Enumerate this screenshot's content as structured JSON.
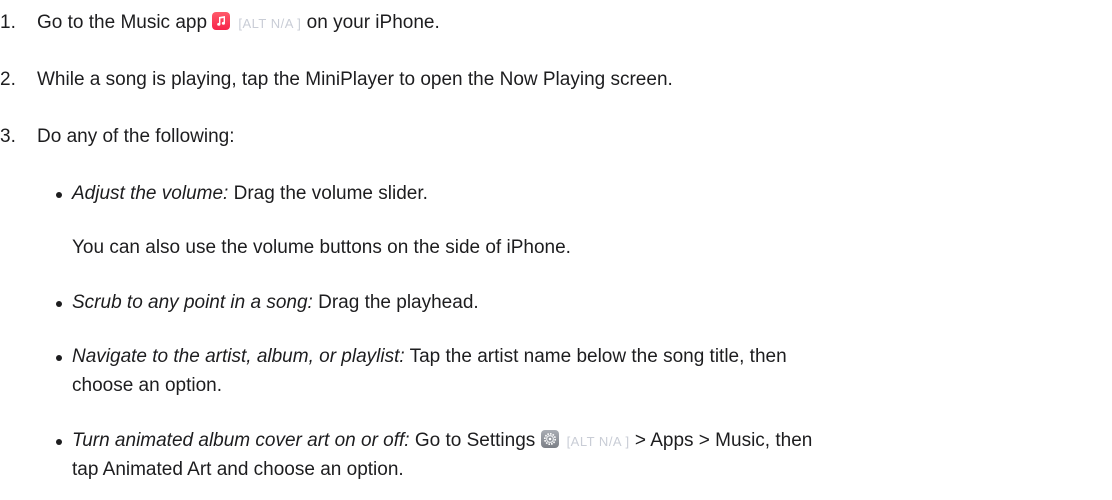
{
  "steps": [
    {
      "number": "1.",
      "pre": "Go to the Music app",
      "alt": "[ALT N/A ]",
      "post": "on your iPhone."
    },
    {
      "number": "2.",
      "text": "While a song is playing, tap the MiniPlayer to open the Now Playing screen."
    },
    {
      "number": "3.",
      "text": "Do any of the following:"
    }
  ],
  "bullets": [
    {
      "term": "Adjust the volume:",
      "desc": "Drag the volume slider.",
      "note": "You can also use the volume buttons on the side of iPhone."
    },
    {
      "term": "Scrub to any point in a song:",
      "desc": "Drag the playhead."
    },
    {
      "term": "Navigate to the artist, album, or playlist:",
      "desc": "Tap the artist name below the song title, then",
      "desc_cont": "choose an option."
    },
    {
      "term": "Turn animated album cover art on or off:",
      "desc_pre": "Go to Settings",
      "alt": "[ALT N/A ]",
      "desc_post": "> Apps > Music, then",
      "desc_cont": "tap Animated Art and choose an option."
    }
  ],
  "icons": {
    "music": "music-note-icon",
    "settings": "gear-icon"
  }
}
